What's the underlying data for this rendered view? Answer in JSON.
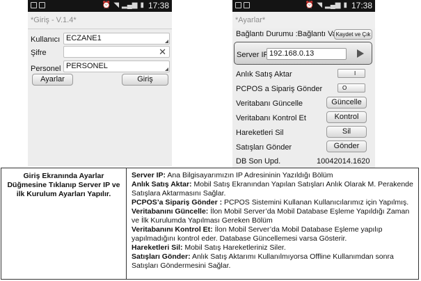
{
  "status_bar": {
    "time": "17:38"
  },
  "login_screen": {
    "title": "*Giriş - V.1.4*",
    "fields": [
      {
        "label": "Kullanıcı",
        "value": "ECZANE1"
      },
      {
        "label": "Şifre",
        "value": ""
      },
      {
        "label": "Personel",
        "value": "PERSONEL"
      }
    ],
    "settings_button": "Ayarlar",
    "login_button": "Giriş"
  },
  "settings_screen": {
    "title": "*Ayarlar*",
    "connection_label": "Bağlantı Durumu :Bağlantı Var",
    "save_button": "Kaydet ve Çık",
    "server_ip_label": "Server IP",
    "server_ip_value": "192.168.0.13",
    "instant_sales_label": "Anlık Satış Aktar",
    "instant_sales_toggle": "I",
    "pcpos_label": "PCPOS a Sipariş Gönder",
    "pcpos_toggle": "O",
    "db_update_label": "Veritabanı Güncelle",
    "db_update_button": "Güncelle",
    "db_check_label": "Veritabanı Kontrol Et",
    "db_check_button": "Kontrol",
    "delete_moves_label": "Hareketleri Sil",
    "delete_moves_button": "Sil",
    "send_sales_label": "Satışları Gönder",
    "send_sales_button": "Gönder",
    "db_last_update_label": "DB Son Upd.",
    "db_last_update_value": "10042014.1620"
  },
  "description": {
    "left_text": "Giriş Ekranında Ayarlar Düğmesine Tıklanıp Server IP ve ilk Kurulum Ayarları Yapılır.",
    "items": [
      {
        "term": "Server IP:",
        "text": " Ana Bilgisayarımızın IP Adresininin Yazıldığı Bölüm"
      },
      {
        "term": "Anlık Satış Aktar:",
        "text": " Mobil Satış Ekranından Yapılan Satışları Anlık Olarak M. Perakende Satışlara Aktarmasını Sağlar."
      },
      {
        "term": "PCPOS’a Sipariş Gönder :",
        "text": " PCPOS Sistemini Kullanan Kullanıcılarımız için Yapılmış."
      },
      {
        "term": "Veritabanını Güncelle:",
        "text": " İlon Mobil Server’da Mobil Database Eşleme Yapıldığı Zaman ve İlk Kurulumda Yapılması Gereken Bölüm"
      },
      {
        "term": "Veritabanını Kontrol Et:",
        "text": " İlon Mobil Server’da Mobil Database Eşleme yapılıp yapılmadığını kontrol eder. Database Güncellemesi varsa Gösterir."
      },
      {
        "term": "Hareketleri Sil:",
        "text": " Mobil Satış Hareketleriniz Siler."
      },
      {
        "term": "Satışları Gönder:",
        "text": " Anlık Satış Aktarımı Kullanılmıyorsa Offline Kullanımdan sonra Satışları Göndermesini Sağlar."
      }
    ]
  }
}
